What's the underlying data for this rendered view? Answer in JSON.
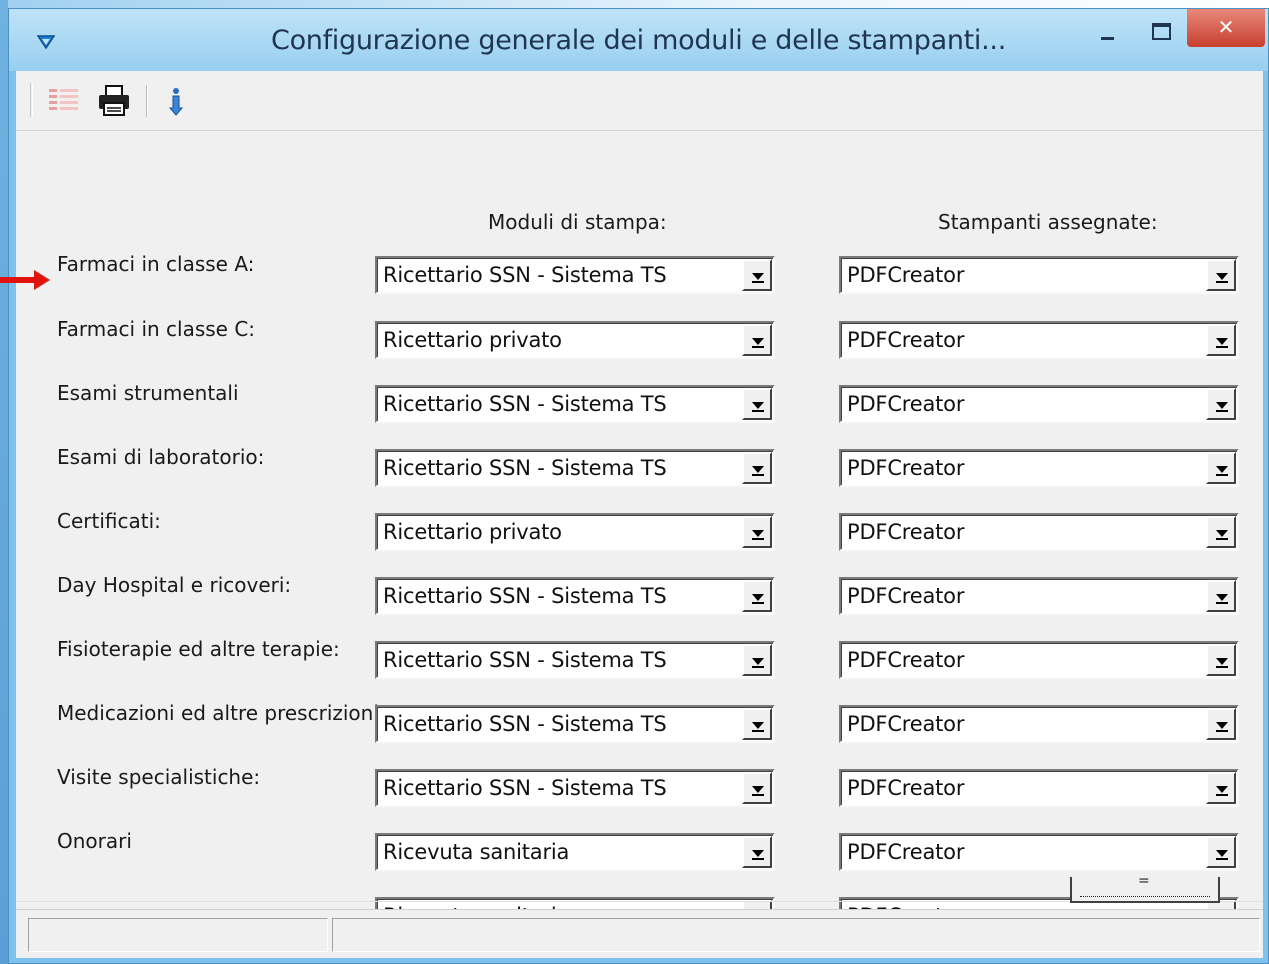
{
  "window": {
    "title": "Configurazione generale dei moduli e delle stampanti..."
  },
  "toolbar": {
    "buttons": [
      {
        "icon": "configure-modules-icon"
      },
      {
        "icon": "printer-icon"
      },
      {
        "icon": "info-icon"
      }
    ]
  },
  "headers": {
    "modules": "Moduli di stampa:",
    "printers": "Stampanti assegnate:"
  },
  "rows": [
    {
      "label": "Farmaci in classe A:",
      "module": "Ricettario SSN - Sistema TS",
      "printer": "PDFCreator"
    },
    {
      "label": "Farmaci in classe C:",
      "module": "Ricettario privato",
      "printer": "PDFCreator"
    },
    {
      "label": "Esami strumentali",
      "module": "Ricettario SSN - Sistema TS",
      "printer": "PDFCreator"
    },
    {
      "label": "Esami di laboratorio:",
      "module": "Ricettario SSN - Sistema TS",
      "printer": "PDFCreator"
    },
    {
      "label": "Certificati:",
      "module": "Ricettario privato",
      "printer": "PDFCreator"
    },
    {
      "label": "Day Hospital e ricoveri:",
      "module": "Ricettario SSN - Sistema TS",
      "printer": "PDFCreator"
    },
    {
      "label": "Fisioterapie ed altre terapie:",
      "module": "Ricettario SSN - Sistema TS",
      "printer": "PDFCreator"
    },
    {
      "label": "Medicazioni ed altre prescrizioni:",
      "module": "Ricettario SSN - Sistema TS",
      "printer": "PDFCreator"
    },
    {
      "label": "Visite specialistiche:",
      "module": "Ricettario SSN - Sistema TS",
      "printer": "PDFCreator"
    },
    {
      "label": "Onorari",
      "module": "Ricevuta sanitaria",
      "printer": "PDFCreator"
    },
    {
      "label": "",
      "module": "Ricevuta sanitaria",
      "printer": "PDFCreator"
    }
  ],
  "colors": {
    "titlebar": "#98cff0",
    "close_button": "#c7402f",
    "annotation_arrow": "#e0140c"
  }
}
